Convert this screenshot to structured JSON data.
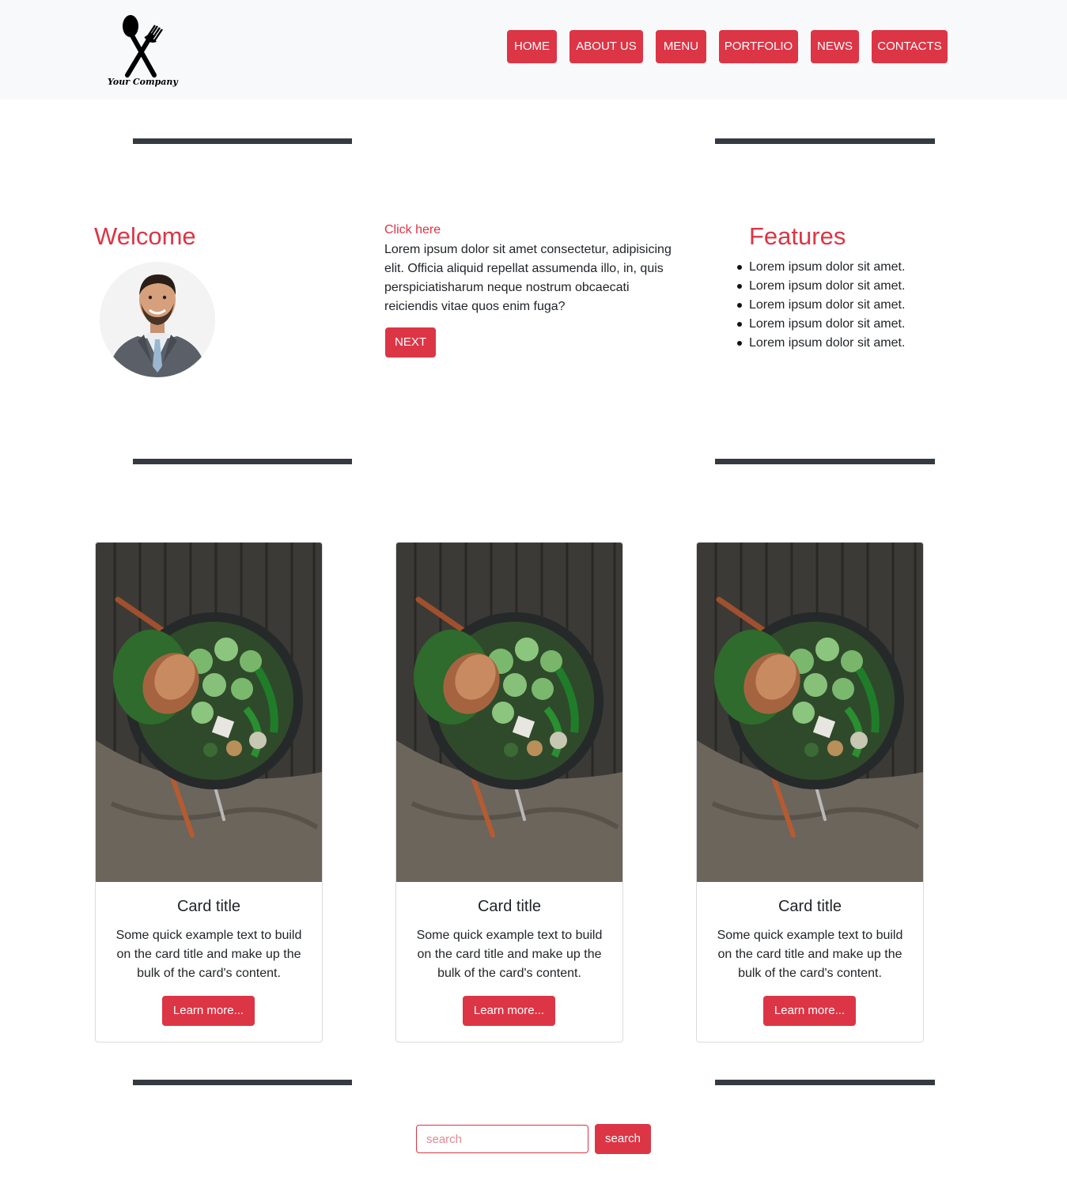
{
  "header": {
    "logo_text": "Your Company",
    "nav": [
      "HOME",
      "ABOUT US",
      "MENU",
      "PORTFOLIO",
      "NEWS",
      "CONTACTS"
    ]
  },
  "intro": {
    "welcome_title": "Welcome",
    "link_text": "Click here",
    "paragraph": "Lorem ipsum dolor sit amet consectetur, adipisicing elit. Officia aliquid repellat assumenda illo, in, quis perspiciatisharum neque nostrum obcaecati reiciendis vitae quos enim fuga?",
    "next_label": "NEXT",
    "features_title": "Features",
    "features": [
      "Lorem ipsum dolor sit amet.",
      "Lorem ipsum dolor sit amet.",
      "Lorem ipsum dolor sit amet.",
      "Lorem ipsum dolor sit amet.",
      "Lorem ipsum dolor sit amet."
    ]
  },
  "cards": [
    {
      "title": "Card title",
      "text": "Some quick example text to build on the card title and make up the bulk of the card's content.",
      "button": "Learn more..."
    },
    {
      "title": "Card title",
      "text": "Some quick example text to build on the card title and make up the bulk of the card's content.",
      "button": "Learn more..."
    },
    {
      "title": "Card title",
      "text": "Some quick example text to build on the card title and make up the bulk of the card's content.",
      "button": "Learn more..."
    }
  ],
  "search": {
    "placeholder": "search",
    "button": "search"
  },
  "colors": {
    "accent": "#dc3545",
    "rule": "#343a40",
    "header_bg": "#f8f9fa"
  }
}
